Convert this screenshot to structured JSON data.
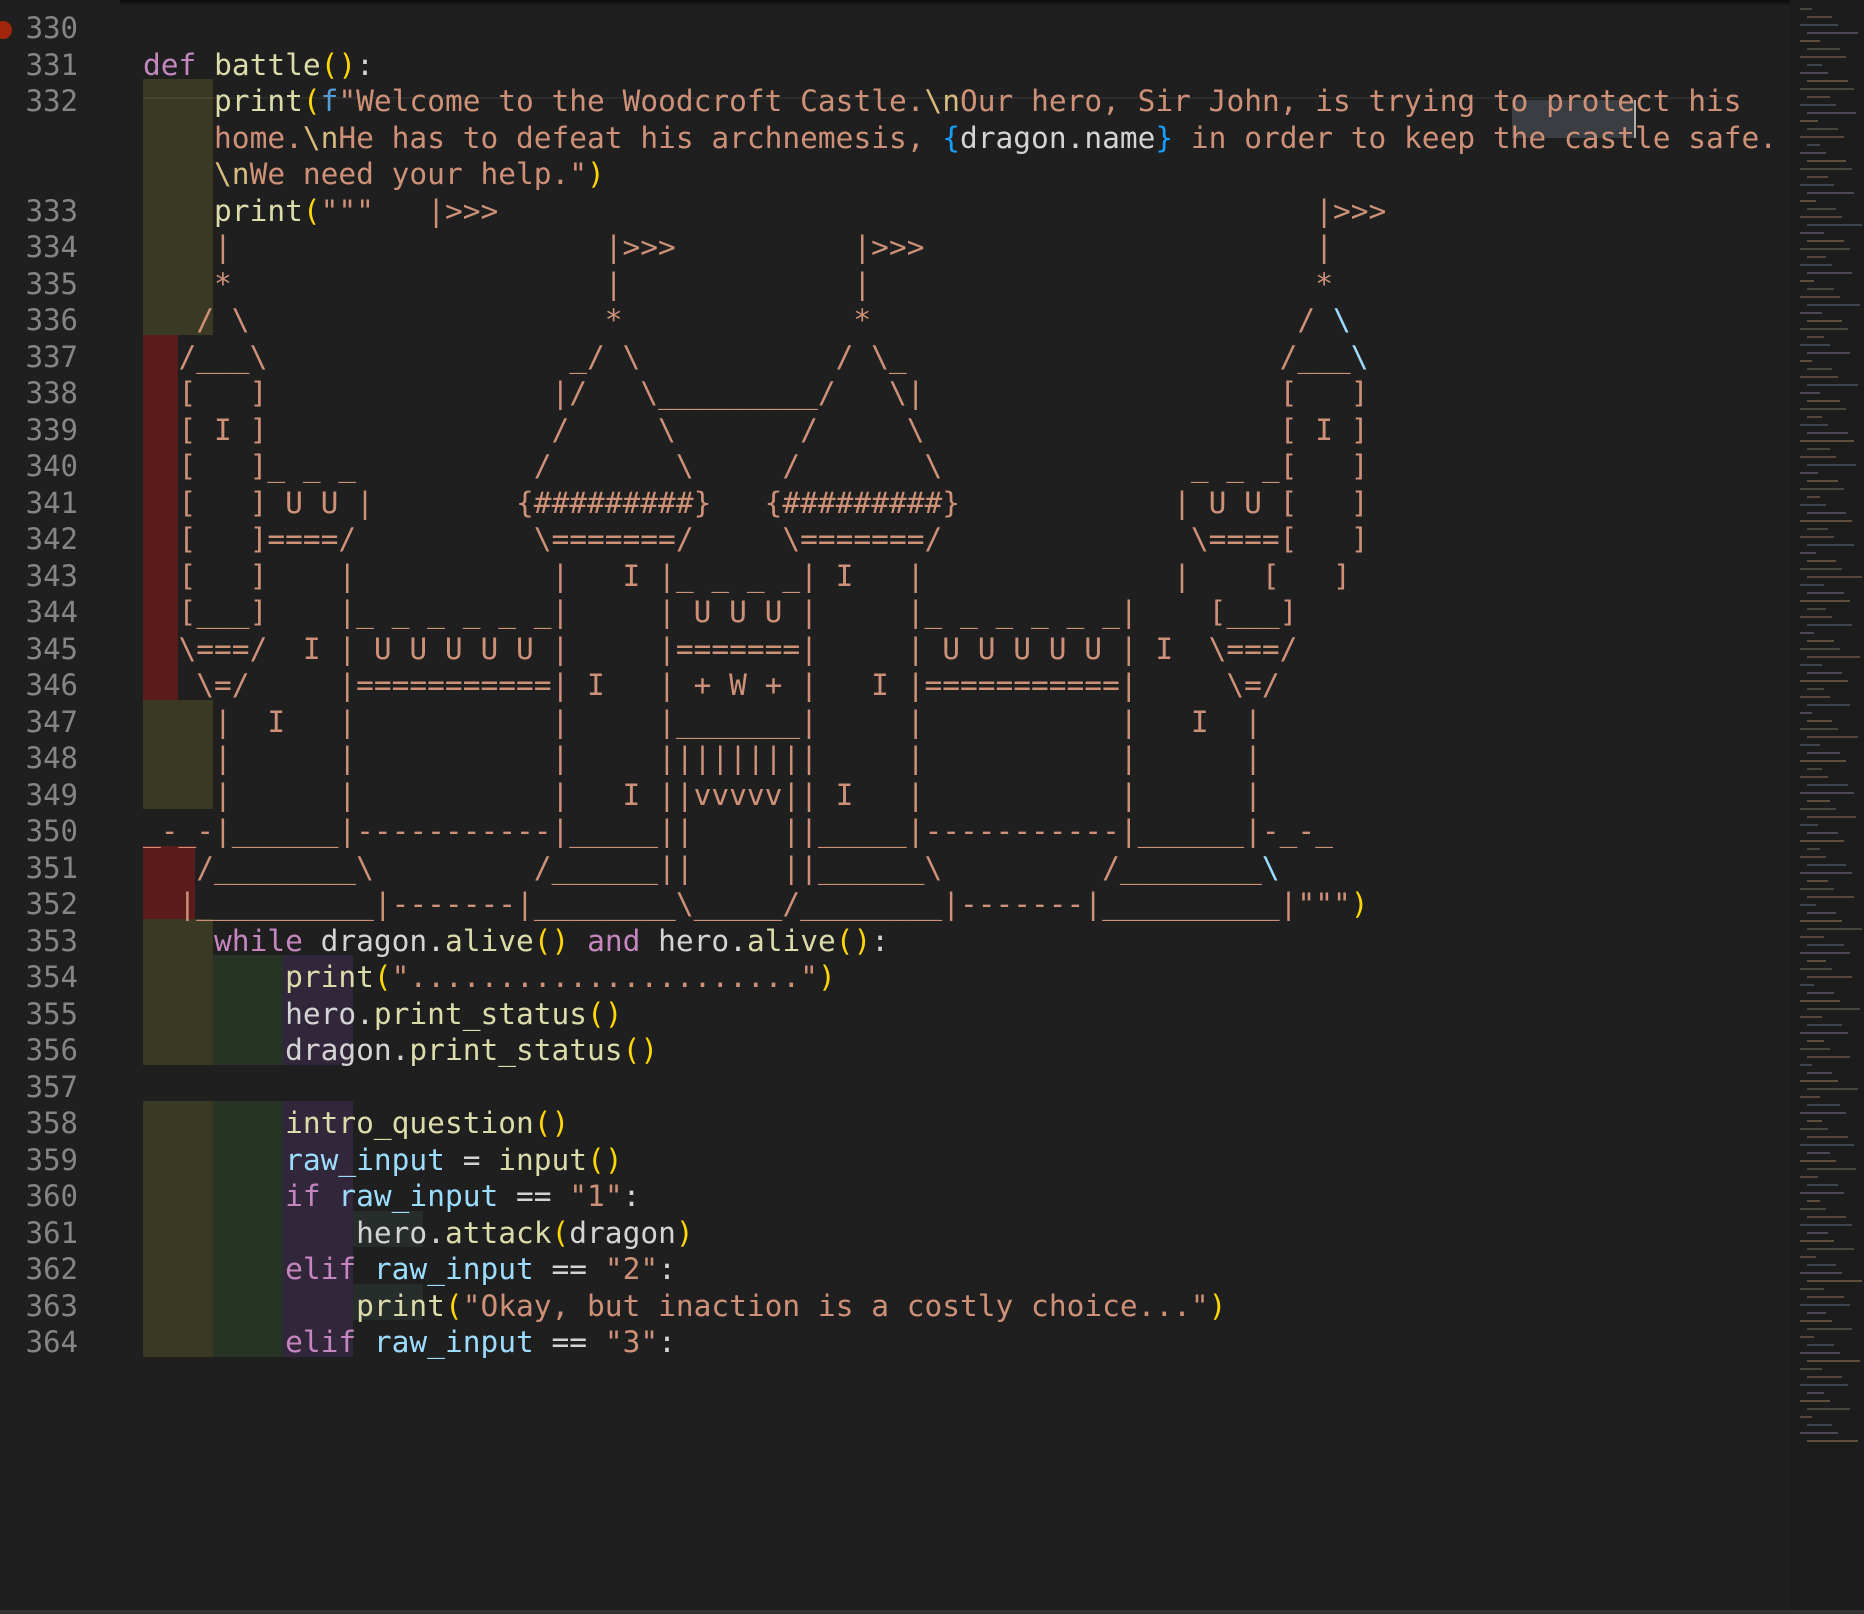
{
  "editor": {
    "language": "python",
    "breakpoint_line": "330",
    "line_numbers": [
      "330",
      "331",
      "332",
      "",
      "",
      "333",
      "334",
      "335",
      "336",
      "337",
      "338",
      "339",
      "340",
      "341",
      "342",
      "343",
      "344",
      "345",
      "346",
      "347",
      "348",
      "349",
      "350",
      "351",
      "352",
      "353",
      "354",
      "355",
      "356",
      "357",
      "358",
      "359",
      "360",
      "361",
      "362",
      "363",
      "364"
    ],
    "lines": [
      [],
      [
        [
          "kw",
          "def"
        ],
        [
          "pl",
          " "
        ],
        [
          "fn",
          "battle"
        ],
        [
          "br",
          "()"
        ],
        [
          "pl",
          ":"
        ]
      ],
      [
        [
          "pl",
          "    "
        ],
        [
          "fn",
          "print"
        ],
        [
          "br",
          "("
        ],
        [
          "fpre",
          "f"
        ],
        [
          "str",
          "\"Welcome to the Woodcroft Castle."
        ],
        [
          "esc",
          "\\n"
        ],
        [
          "str",
          "Our hero, Sir John, is trying to protect his"
        ]
      ],
      [
        [
          "pl",
          "    "
        ],
        [
          "str",
          "home."
        ],
        [
          "esc",
          "\\n"
        ],
        [
          "str",
          "He has to defeat his archnemesis, "
        ],
        [
          "brb",
          "{"
        ],
        [
          "pl",
          "dragon.name"
        ],
        [
          "brb",
          "}"
        ],
        [
          "str",
          " in order to keep the castle safe."
        ]
      ],
      [
        [
          "pl",
          "    "
        ],
        [
          "esc",
          "\\n"
        ],
        [
          "str",
          "We need your help.\""
        ],
        [
          "br",
          ")"
        ]
      ],
      [
        [
          "pl",
          "    "
        ],
        [
          "fn",
          "print"
        ],
        [
          "br",
          "("
        ],
        [
          "str",
          "\"\"\"   |>>>                                              |>>>"
        ]
      ],
      [
        [
          "str",
          "    |                     |>>>          |>>>                      |"
        ]
      ],
      [
        [
          "str",
          "    *                     |             |                         *"
        ]
      ],
      [
        [
          "str",
          "   / \\                    *             *                        / "
        ],
        [
          "var",
          "\\"
        ]
      ],
      [
        [
          "str",
          "  /___\\                 _/ \\           / \\_                     /___"
        ],
        [
          "var",
          "\\"
        ]
      ],
      [
        [
          "str",
          "  [   ]                |/   \\_________/   \\|                    [   ]"
        ]
      ],
      [
        [
          "str",
          "  [ I ]                /     \\       /     \\                    [ I ]"
        ]
      ],
      [
        [
          "str",
          "  [   ]_ _ _          /       \\     /       \\              _ _ _[   ]"
        ]
      ],
      [
        [
          "str",
          "  [   ] U U |        {#########}   {#########}            | U U [   ]"
        ]
      ],
      [
        [
          "str",
          "  [   ]====/          \\=======/     \\=======/              \\====[   ]"
        ]
      ],
      [
        [
          "str",
          "  [   ]    |           |   I |_ _ _ _| I   |              |    [   ]"
        ]
      ],
      [
        [
          "str",
          "  [___]    |_ _ _ _ _ _|     | U U U |     |_ _ _ _ _ _|    [___]"
        ]
      ],
      [
        [
          "str",
          "  \\===/  I | U U U U U |     |=======|     | U U U U U | I  \\===/"
        ]
      ],
      [
        [
          "str",
          "   \\=/     |===========| I   | + W + |   I |===========|     \\=/"
        ]
      ],
      [
        [
          "str",
          "    |  I   |           |     |_______|     |           |   I  |"
        ]
      ],
      [
        [
          "str",
          "    |      |           |     |||||||||     |           |      |"
        ]
      ],
      [
        [
          "str",
          "    |      |           |   I ||vvvvv|| I   |           |      |"
        ]
      ],
      [
        [
          "str",
          "_-_-|______|-----------|_____||     ||_____|-----------|______|-_-_"
        ]
      ],
      [
        [
          "str",
          "   /________\\         /______||     ||______\\         /________"
        ],
        [
          "var",
          "\\"
        ]
      ],
      [
        [
          "str",
          "  |__________|-------|________\\_____/________|-------|__________|\"\"\""
        ],
        [
          "br",
          ")"
        ]
      ],
      [
        [
          "pl",
          "    "
        ],
        [
          "kw",
          "while"
        ],
        [
          "pl",
          " dragon."
        ],
        [
          "fn",
          "alive"
        ],
        [
          "br",
          "()"
        ],
        [
          "pl",
          " "
        ],
        [
          "kw",
          "and"
        ],
        [
          "pl",
          " hero."
        ],
        [
          "fn",
          "alive"
        ],
        [
          "br",
          "()"
        ],
        [
          "pl",
          ":"
        ]
      ],
      [
        [
          "pl",
          "        "
        ],
        [
          "fn",
          "print"
        ],
        [
          "br",
          "("
        ],
        [
          "str",
          "\"......................\""
        ],
        [
          "br",
          ")"
        ]
      ],
      [
        [
          "pl",
          "        hero."
        ],
        [
          "fn",
          "print_status"
        ],
        [
          "br",
          "()"
        ]
      ],
      [
        [
          "pl",
          "        dragon."
        ],
        [
          "fn",
          "print_status"
        ],
        [
          "br",
          "()"
        ]
      ],
      [],
      [
        [
          "pl",
          "        "
        ],
        [
          "fn",
          "intro_question"
        ],
        [
          "br",
          "()"
        ]
      ],
      [
        [
          "pl",
          "        "
        ],
        [
          "var",
          "raw_input"
        ],
        [
          "pl",
          " = "
        ],
        [
          "fn",
          "input"
        ],
        [
          "br",
          "()"
        ]
      ],
      [
        [
          "pl",
          "        "
        ],
        [
          "kw",
          "if"
        ],
        [
          "pl",
          " "
        ],
        [
          "var",
          "raw_input"
        ],
        [
          "pl",
          " == "
        ],
        [
          "str",
          "\"1\""
        ],
        [
          "pl",
          ":"
        ]
      ],
      [
        [
          "pl",
          "            hero."
        ],
        [
          "fn",
          "attack"
        ],
        [
          "br",
          "("
        ],
        [
          "pl",
          "dragon"
        ],
        [
          "br",
          ")"
        ]
      ],
      [
        [
          "pl",
          "        "
        ],
        [
          "kw",
          "elif"
        ],
        [
          "pl",
          " "
        ],
        [
          "var",
          "raw_input"
        ],
        [
          "pl",
          " == "
        ],
        [
          "str",
          "\"2\""
        ],
        [
          "pl",
          ":"
        ]
      ],
      [
        [
          "pl",
          "            "
        ],
        [
          "fn",
          "print"
        ],
        [
          "br",
          "("
        ],
        [
          "str",
          "\"Okay, but inaction is a costly choice...\""
        ],
        [
          "br",
          ")"
        ]
      ],
      [
        [
          "pl",
          "        "
        ],
        [
          "kw",
          "elif"
        ],
        [
          "pl",
          " "
        ],
        [
          "var",
          "raw_input"
        ],
        [
          "pl",
          " == "
        ],
        [
          "str",
          "\"3\""
        ],
        [
          "pl",
          ":"
        ]
      ]
    ]
  },
  "colors": {
    "background": "#1f1f1f",
    "line_number": "#858585",
    "keyword": "#c586c0",
    "function": "#dcdcaa",
    "string": "#ce9178",
    "variable": "#9cdcfe",
    "bracket_gold": "#ffd700",
    "indent_olive": "#3a3a24",
    "indent_green": "#263325",
    "indent_purple": "#32273a",
    "indent_error_red": "#5c1b1b"
  }
}
